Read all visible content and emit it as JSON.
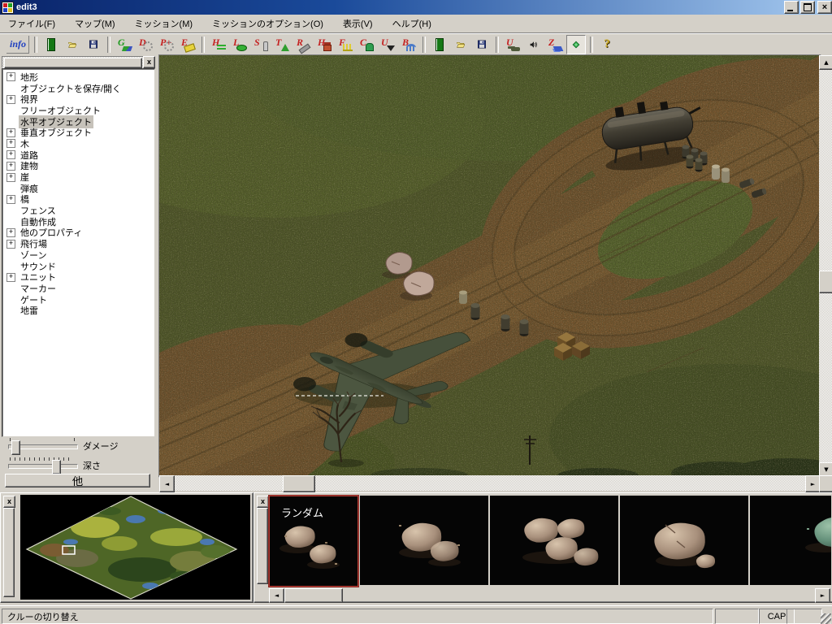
{
  "window": {
    "title": "edit3"
  },
  "menu": {
    "items": [
      "ファイル(F)",
      "マップ(M)",
      "ミッション(M)",
      "ミッションのオプション(O)",
      "表示(V)",
      "ヘルプ(H)"
    ]
  },
  "toolbar": {
    "info": "info",
    "help": "?",
    "letters": {
      "g": "G",
      "d": "D",
      "p": "P+",
      "e": "E",
      "h": "H",
      "l": "L",
      "s": "S",
      "t": "T",
      "r": "R",
      "h2": "H",
      "f": "F",
      "c": "C",
      "u": "U",
      "b": "B",
      "unit": "U",
      "z": "Z"
    }
  },
  "sidebar": {
    "tree": [
      {
        "label": "地形",
        "expandable": true
      },
      {
        "label": "オブジェクトを保存/開く"
      },
      {
        "label": "視界",
        "expandable": true
      },
      {
        "label": "フリーオブジェクト"
      },
      {
        "label": "水平オブジェクト",
        "selected": true
      },
      {
        "label": "垂直オブジェクト",
        "expandable": true
      },
      {
        "label": "木",
        "expandable": true
      },
      {
        "label": "道路",
        "expandable": true
      },
      {
        "label": "建物",
        "expandable": true
      },
      {
        "label": "崖",
        "expandable": true
      },
      {
        "label": "弾痕"
      },
      {
        "label": "橋",
        "expandable": true
      },
      {
        "label": "フェンス"
      },
      {
        "label": "自動作成"
      },
      {
        "label": "他のプロパティ",
        "expandable": true
      },
      {
        "label": "飛行場",
        "expandable": true
      },
      {
        "label": "ゾーン"
      },
      {
        "label": "サウンド"
      },
      {
        "label": "ユニット",
        "expandable": true
      },
      {
        "label": "マーカー"
      },
      {
        "label": "ゲート"
      },
      {
        "label": "地雷"
      }
    ],
    "sliders": [
      {
        "label": "ダメージ"
      },
      {
        "label": "深さ"
      }
    ],
    "more_button": "他"
  },
  "palette": {
    "random_label": "ランダム"
  },
  "statusbar": {
    "message": "クルーの切り替え",
    "cap": "CAP"
  },
  "colors": {
    "titlebar_left": "#0a246a",
    "titlebar_right": "#a6caf0",
    "chrome": "#d4d0c8",
    "grass": "#4c5426",
    "dirt": "#6e4f2b",
    "selection_red": "#b23c34"
  }
}
